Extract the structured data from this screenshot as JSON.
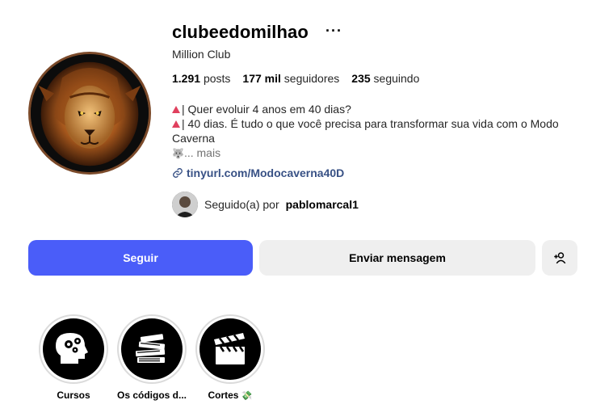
{
  "profile": {
    "username": "clubeedomilhao",
    "more_icon": "···",
    "full_name": "Million Club"
  },
  "stats": {
    "posts_count": "1.291",
    "posts_label": "posts",
    "followers_count": "177 mil",
    "followers_label": "seguidores",
    "following_count": "235",
    "following_label": "seguindo"
  },
  "bio": {
    "line1": "| Quer evoluir 4 anos em 40 dias?",
    "line2": "| 40 dias. É tudo o que você precisa para transformar sua vida com o Modo Caverna",
    "wolf_emoji": "🐺",
    "more_label": "... mais",
    "bullet_color": "#e0405e"
  },
  "link": {
    "text": "tinyurl.com/Modocaverna40D",
    "color": "#385185"
  },
  "followed_by": {
    "prefix": "Seguido(a) por",
    "user": "pablomarcal1"
  },
  "actions": {
    "follow_label": "Seguir",
    "message_label": "Enviar mensagem",
    "add_user_icon": "add-person-icon",
    "follow_color": "#4a5df9"
  },
  "highlights": [
    {
      "label": "Cursos",
      "icon": "head-gears-icon"
    },
    {
      "label": "Os códigos d...",
      "icon": "books-icon"
    },
    {
      "label": "Cortes",
      "icon": "clapperboard-icon",
      "emoji": "💸"
    }
  ]
}
